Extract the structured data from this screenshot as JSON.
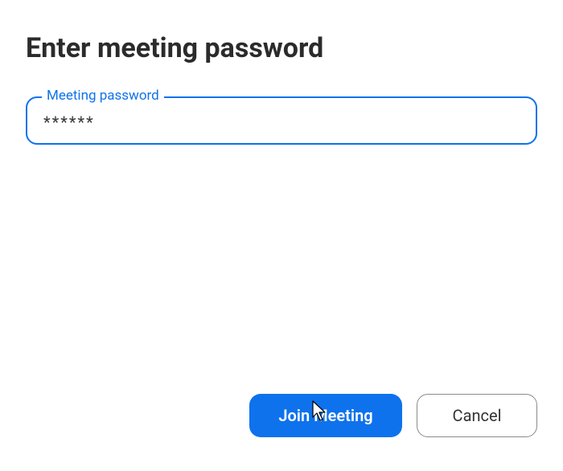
{
  "dialog": {
    "title": "Enter meeting password",
    "field": {
      "label": "Meeting password",
      "masked_value": "******"
    },
    "actions": {
      "primary": "Join Meeting",
      "secondary": "Cancel"
    }
  },
  "colors": {
    "accent": "#0e72ed"
  }
}
